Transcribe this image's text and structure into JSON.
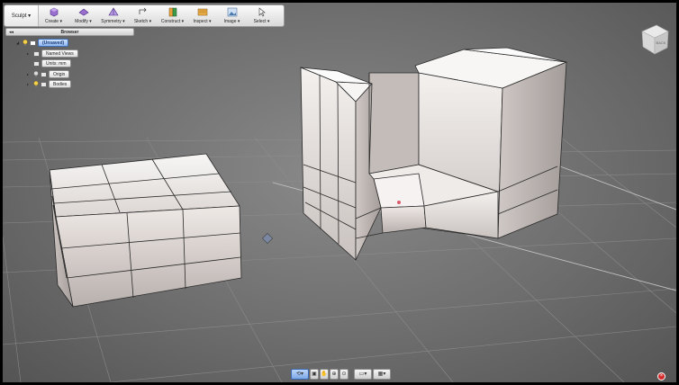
{
  "toolbar": {
    "workspace": "Sculpt ▾",
    "groups": [
      {
        "label": "Create ▾",
        "icon": "create-box-icon"
      },
      {
        "label": "Modify ▾",
        "icon": "modify-icon"
      },
      {
        "label": "Symmetry ▾",
        "icon": "symmetry-icon"
      },
      {
        "label": "Sketch ▾",
        "icon": "sketch-icon"
      },
      {
        "label": "Construct ▾",
        "icon": "construct-plane-icon"
      },
      {
        "label": "Inspect ▾",
        "icon": "inspect-icon"
      },
      {
        "label": "Image ▾",
        "icon": "image-icon"
      },
      {
        "label": "Select ▾",
        "icon": "select-arrow-icon"
      }
    ]
  },
  "browser": {
    "title": "Browser",
    "collapse": "◂◂",
    "items": [
      {
        "label": "(Unsaved)",
        "active": true
      },
      {
        "label": "Named Views"
      },
      {
        "label": "Units: mm"
      },
      {
        "label": "Origin"
      },
      {
        "label": "Bodies"
      }
    ]
  },
  "viewcube": {
    "face": "BACK"
  },
  "colors": {
    "accent": "#3d69b0",
    "background": "#6e6e6e",
    "model_face": "#e8e2df"
  }
}
